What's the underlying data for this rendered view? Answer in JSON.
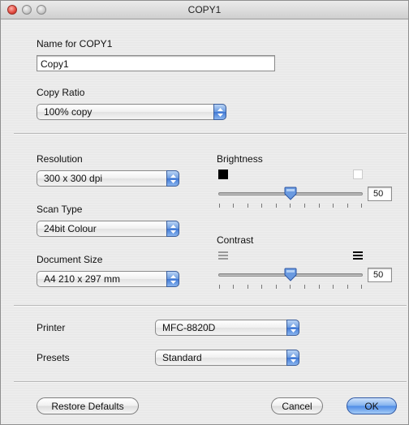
{
  "window": {
    "title": "COPY1"
  },
  "name": {
    "label": "Name for COPY1",
    "value": "Copy1"
  },
  "copy_ratio": {
    "label": "Copy Ratio",
    "value": "100% copy"
  },
  "resolution": {
    "label": "Resolution",
    "value": "300 x 300 dpi"
  },
  "scan_type": {
    "label": "Scan Type",
    "value": "24bit Colour"
  },
  "document_size": {
    "label": "Document Size",
    "value": "A4 210 x 297 mm"
  },
  "brightness": {
    "label": "Brightness",
    "value": "50",
    "level_fraction": 0.5
  },
  "contrast": {
    "label": "Contrast",
    "value": "50",
    "level_fraction": 0.5
  },
  "printer": {
    "label": "Printer",
    "value": "MFC-8820D"
  },
  "presets": {
    "label": "Presets",
    "value": "Standard"
  },
  "buttons": {
    "restore": "Restore Defaults",
    "cancel": "Cancel",
    "ok": "OK"
  },
  "colors": {
    "accent_blue": "#4c8ae6",
    "close_red": "#e0483e"
  }
}
